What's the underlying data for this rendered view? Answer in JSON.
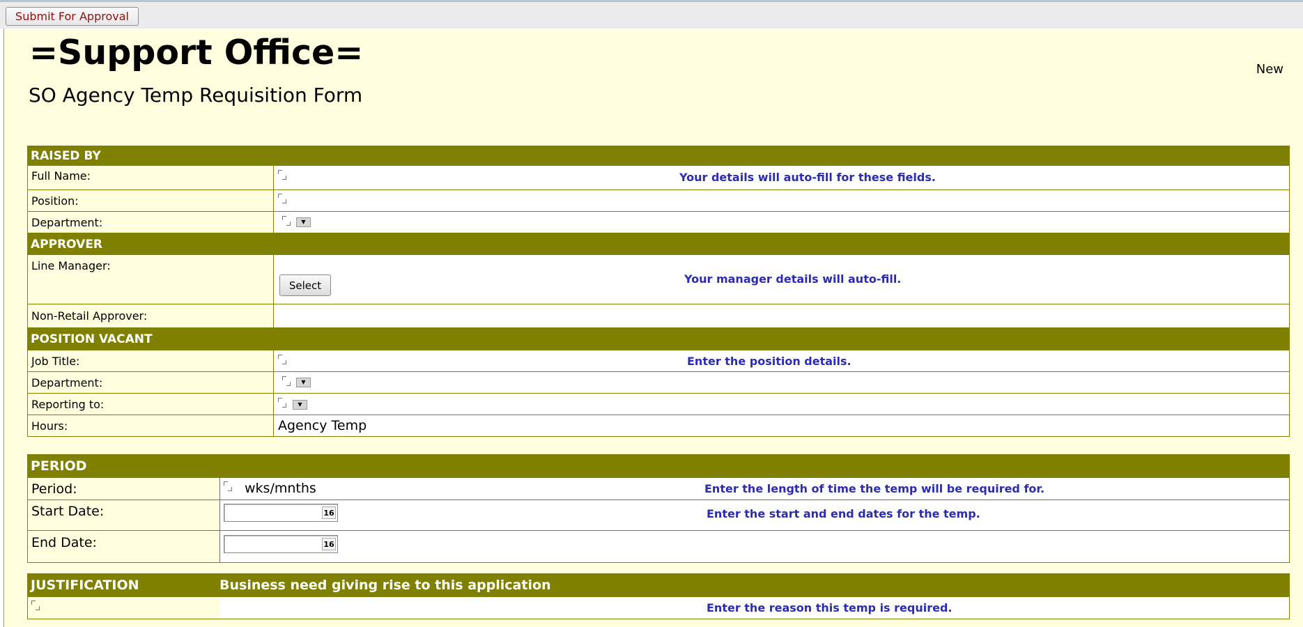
{
  "toolbar": {
    "submit_label": "Submit For Approval"
  },
  "form": {
    "brand": "=Support Office=",
    "subtitle": "SO Agency Temp Requisition Form",
    "status": "New"
  },
  "raised_by": {
    "header": "RAISED BY",
    "full_name_label": "Full Name:",
    "position_label": "Position:",
    "department_label": "Department:",
    "hint": "Your details will auto-fill for these fields."
  },
  "approver": {
    "header": "APPROVER",
    "line_manager_label": "Line Manager:",
    "select_label": "Select",
    "hint": "Your manager details will auto-fill.",
    "non_retail_label": "Non-Retail Approver:"
  },
  "position_vacant": {
    "header": "POSITION VACANT",
    "job_title_label": "Job Title:",
    "department_label": "Department:",
    "reporting_label": "Reporting to:",
    "hours_label": "Hours:",
    "hours_value": "Agency Temp",
    "hint": "Enter the position details."
  },
  "period": {
    "header": "PERIOD",
    "period_label": "Period:",
    "period_unit": "wks/mnths",
    "period_hint": "Enter the length of time the temp will be required for.",
    "start_label": "Start Date:",
    "start_hint": "Enter the start and end dates for the temp.",
    "end_label": "End Date:",
    "calendar_icon_text": "16"
  },
  "justification": {
    "header": "JUSTIFICATION",
    "header_sub": "Business need giving rise to this application",
    "hint": "Enter the reason this temp is required."
  },
  "colors": {
    "header_bg": "#808000",
    "form_bg": "#ffffe0",
    "hint_text": "#2b2bb5",
    "submit_text": "#8b1111"
  }
}
